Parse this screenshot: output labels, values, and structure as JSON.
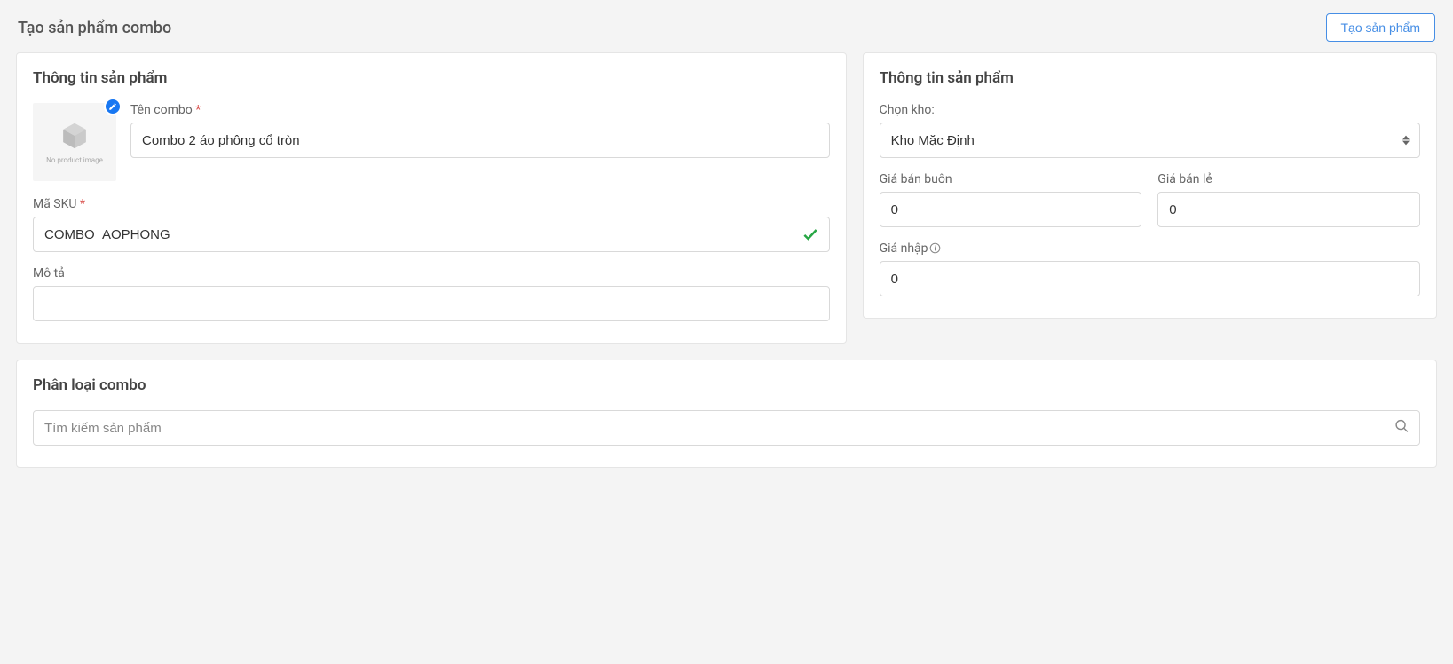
{
  "header": {
    "title": "Tạo sản phẩm combo",
    "create_button": "Tạo sản phẩm"
  },
  "product_info_left": {
    "card_title": "Thông tin sản phẩm",
    "no_image_text": "No product image",
    "combo_name_label": "Tên combo",
    "combo_name_value": "Combo 2 áo phông cổ tròn",
    "sku_label": "Mã SKU",
    "sku_value": "COMBO_AOPHONG",
    "description_label": "Mô tả",
    "description_value": ""
  },
  "product_info_right": {
    "card_title": "Thông tin sản phẩm",
    "warehouse_label": "Chọn kho:",
    "warehouse_value": "Kho Mặc Định",
    "wholesale_label": "Giá bán buôn",
    "wholesale_value": "0",
    "retail_label": "Giá bán lẻ",
    "retail_value": "0",
    "import_price_label": "Giá nhập",
    "import_price_value": "0"
  },
  "combo_classify": {
    "card_title": "Phân loại combo",
    "search_placeholder": "Tìm kiếm sản phẩm"
  }
}
